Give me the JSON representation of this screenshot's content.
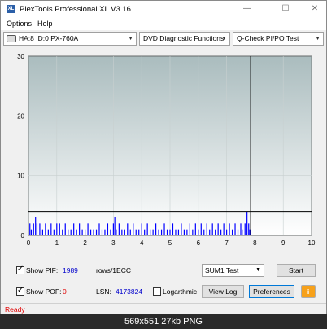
{
  "window": {
    "title": "PlexTools Professional XL V3.16",
    "icon_text": "XL"
  },
  "menu": {
    "items": [
      "Options",
      "Help"
    ]
  },
  "toolbar": {
    "drive": "HA:8 ID:0  PX-760A",
    "function": "DVD Diagnostic Functions",
    "test": "Q-Check PI/PO Test"
  },
  "chart_data": {
    "type": "bar",
    "x": {
      "ticks": [
        "0",
        "1",
        "2",
        "3",
        "4",
        "5",
        "6",
        "7",
        "8",
        "9",
        "10"
      ],
      "range": [
        0,
        10
      ]
    },
    "y": {
      "ticks": [
        "0",
        "10",
        "20",
        "30"
      ],
      "range": [
        0,
        30
      ]
    },
    "threshold_line": 4,
    "end_marker_x": 7.85,
    "series_color": "#0000ff",
    "grid": true,
    "bars_pif": [
      [
        0.05,
        2
      ],
      [
        0.1,
        1
      ],
      [
        0.18,
        2
      ],
      [
        0.25,
        3
      ],
      [
        0.3,
        2
      ],
      [
        0.4,
        2
      ],
      [
        0.5,
        1
      ],
      [
        0.6,
        2
      ],
      [
        0.7,
        1
      ],
      [
        0.8,
        2
      ],
      [
        0.9,
        1
      ],
      [
        1.0,
        2
      ],
      [
        1.1,
        2
      ],
      [
        1.2,
        1
      ],
      [
        1.3,
        2
      ],
      [
        1.4,
        1
      ],
      [
        1.5,
        1
      ],
      [
        1.6,
        2
      ],
      [
        1.7,
        1
      ],
      [
        1.8,
        2
      ],
      [
        1.9,
        1
      ],
      [
        2.0,
        1
      ],
      [
        2.1,
        2
      ],
      [
        2.2,
        1
      ],
      [
        2.3,
        1
      ],
      [
        2.4,
        1
      ],
      [
        2.5,
        2
      ],
      [
        2.6,
        1
      ],
      [
        2.7,
        1
      ],
      [
        2.8,
        2
      ],
      [
        2.9,
        1
      ],
      [
        3.0,
        2
      ],
      [
        3.05,
        3
      ],
      [
        3.1,
        1
      ],
      [
        3.2,
        2
      ],
      [
        3.3,
        1
      ],
      [
        3.4,
        1
      ],
      [
        3.5,
        2
      ],
      [
        3.6,
        1
      ],
      [
        3.7,
        2
      ],
      [
        3.8,
        1
      ],
      [
        3.9,
        1
      ],
      [
        4.0,
        2
      ],
      [
        4.1,
        1
      ],
      [
        4.2,
        2
      ],
      [
        4.3,
        1
      ],
      [
        4.4,
        1
      ],
      [
        4.5,
        2
      ],
      [
        4.6,
        1
      ],
      [
        4.7,
        1
      ],
      [
        4.8,
        2
      ],
      [
        4.9,
        1
      ],
      [
        5.0,
        1
      ],
      [
        5.1,
        2
      ],
      [
        5.2,
        1
      ],
      [
        5.3,
        1
      ],
      [
        5.4,
        2
      ],
      [
        5.5,
        1
      ],
      [
        5.6,
        1
      ],
      [
        5.7,
        2
      ],
      [
        5.8,
        1
      ],
      [
        5.9,
        2
      ],
      [
        6.0,
        1
      ],
      [
        6.1,
        2
      ],
      [
        6.2,
        1
      ],
      [
        6.3,
        2
      ],
      [
        6.4,
        1
      ],
      [
        6.5,
        2
      ],
      [
        6.6,
        1
      ],
      [
        6.7,
        2
      ],
      [
        6.8,
        1
      ],
      [
        6.9,
        2
      ],
      [
        7.0,
        1
      ],
      [
        7.1,
        2
      ],
      [
        7.2,
        1
      ],
      [
        7.3,
        2
      ],
      [
        7.4,
        1
      ],
      [
        7.5,
        2
      ],
      [
        7.55,
        1
      ],
      [
        7.65,
        2
      ],
      [
        7.72,
        4
      ],
      [
        7.78,
        2
      ],
      [
        7.82,
        1
      ]
    ]
  },
  "controls": {
    "show_pif_label": "Show PIF:",
    "pif_value": "1989",
    "rows_label": "rows/1ECC",
    "show_pof_label": "Show POF:",
    "pof_value": "0",
    "lsn_label": "LSN:",
    "lsn_value": "4173824",
    "logarithmic_label": "Logarthmic",
    "sum_select": "SUM1 Test",
    "start_button": "Start",
    "view_log_button": "View Log",
    "preferences_button": "Preferences",
    "info_icon": "i"
  },
  "status": {
    "text": "Ready"
  },
  "caption": {
    "text": "569x551  27kb  PNG"
  },
  "colors": {
    "bar_blue": "#0000ff",
    "status_red": "#e00000",
    "value_blue": "#0000cc"
  }
}
